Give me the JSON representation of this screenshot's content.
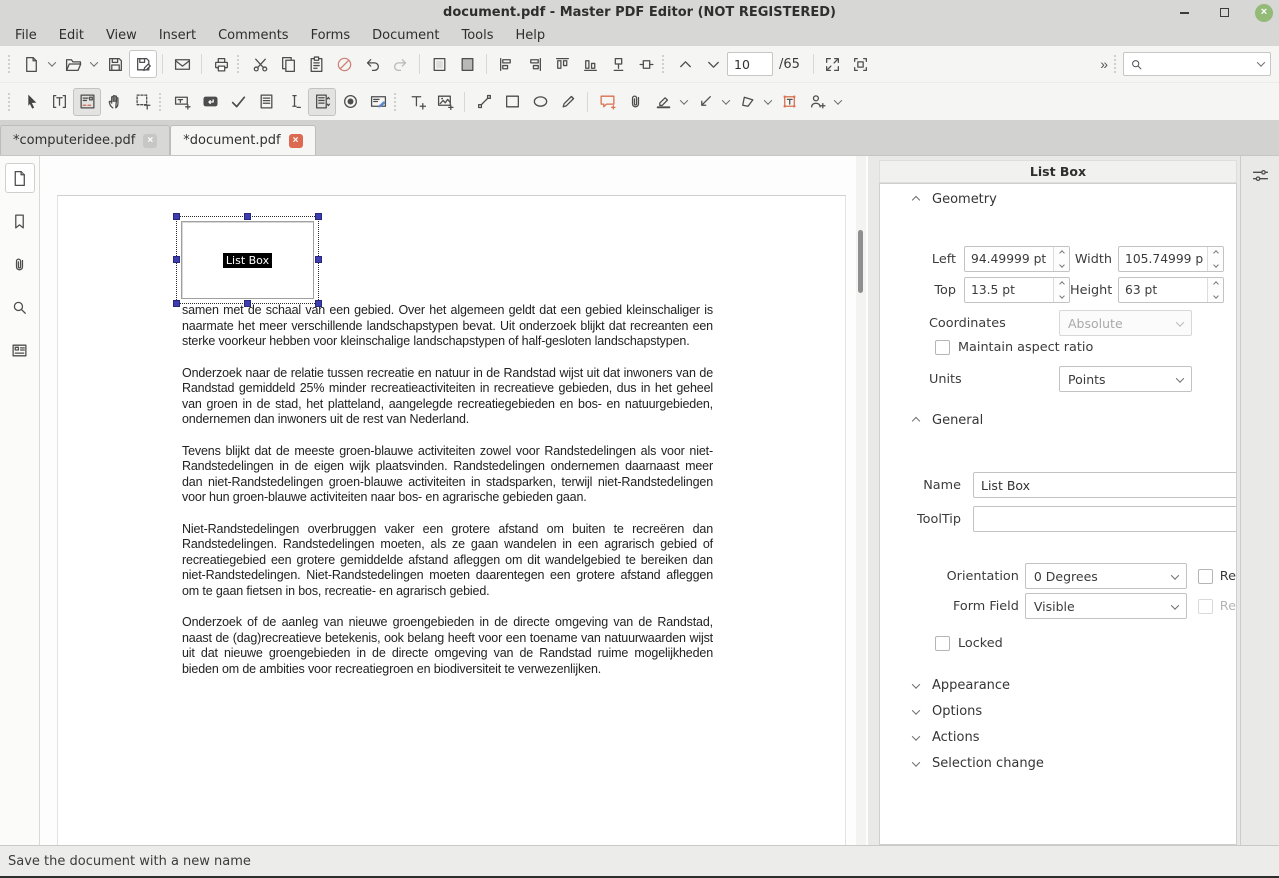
{
  "window": {
    "title": "document.pdf - Master PDF Editor (NOT REGISTERED)"
  },
  "menu": {
    "items": [
      "File",
      "Edit",
      "View",
      "Insert",
      "Comments",
      "Forms",
      "Document",
      "Tools",
      "Help"
    ]
  },
  "toolbar": {
    "page_number": "10",
    "page_total": "/65",
    "search_value": ""
  },
  "icons": {
    "overflow": "»",
    "close_x": "×",
    "minimize": "–"
  },
  "tabs": {
    "items": [
      {
        "label": "*computeridee.pdf"
      },
      {
        "label": "*document.pdf"
      }
    ]
  },
  "document": {
    "field_label": "List Box",
    "paragraphs": [
      "samen met de schaal van een gebied. Over het algemeen geldt dat een gebied kleinschaliger is naarmate het meer verschillende landschapstypen bevat. Uit onderzoek blijkt dat recreanten een sterke voorkeur hebben voor kleinschalige landschapstypen of half-gesloten landschapstypen.",
      "Onderzoek naar de relatie tussen recreatie en natuur in de Randstad wijst uit dat inwoners van de Randstad gemiddeld 25% minder recreatieactiviteiten in recreatieve gebieden, dus in het geheel van groen in de stad, het platteland, aangelegde recreatiegebieden en bos- en natuurgebieden, ondernemen dan inwoners uit de rest van Nederland.",
      "Tevens blijkt dat de meeste groen-blauwe activiteiten zowel voor Randstedelingen als voor niet-Randstedelingen in de eigen wijk plaatsvinden. Randstedelingen ondernemen daarnaast meer dan niet-Randstedelingen groen-blauwe activiteiten in stadsparken, terwijl niet-Randstedelingen voor hun groen-blauwe activiteiten naar bos- en agrarische gebieden gaan.",
      "Niet-Randstedelingen overbruggen vaker een grotere afstand om buiten te recreëren dan Randstedelingen. Randstedelingen moeten, als ze gaan wandelen in een agrarisch gebied of recreatiegebied een grotere gemiddelde afstand afleggen om dit wandelgebied te bereiken dan niet-Randstedelingen. Niet-Randstedelingen moeten daarentegen een grotere afstand afleggen om te gaan fietsen in bos, recreatie- en agrarisch gebied.",
      "Onderzoek of de aanleg van nieuwe groengebieden in de directe omgeving van de Randstad, naast de (dag)recreatieve betekenis, ook belang heeft voor een toename van natuurwaarden wijst uit dat nieuwe groengebieden in de directe omgeving van de Randstad ruime mogelijkheden bieden om de ambities voor recreatiegroen en biodiversiteit te verwezenlijken."
    ]
  },
  "panel": {
    "title": "List Box",
    "geometry": {
      "header": "Geometry",
      "left_label": "Left",
      "left_value": "94.49999 pt",
      "width_label": "Width",
      "width_value": "105.74999 p",
      "top_label": "Top",
      "top_value": "13.5 pt",
      "height_label": "Height",
      "height_value": "63 pt",
      "coordinates_label": "Coordinates",
      "coordinates_value": "Absolute",
      "maintain_aspect_label": "Maintain aspect ratio",
      "units_label": "Units",
      "units_value": "Points"
    },
    "general": {
      "header": "General",
      "name_label": "Name",
      "name_value": "List Box",
      "tooltip_label": "ToolTip",
      "tooltip_value": "",
      "orientation_label": "Orientation",
      "orientation_value": "0 Degrees",
      "orientation_checkbox_label": "Re",
      "form_field_label": "Form Field",
      "form_field_value": "Visible",
      "form_field_checkbox_label": "Re",
      "locked_label": "Locked"
    },
    "collapsed_sections": [
      "Appearance",
      "Options",
      "Actions",
      "Selection change"
    ]
  },
  "statusbar": {
    "text": "Save the document with a new name"
  },
  "colors": {
    "annotation_red": "#d9704f",
    "close_button_green": "#94ba77",
    "selection_handle_blue": "#3d3daf"
  }
}
